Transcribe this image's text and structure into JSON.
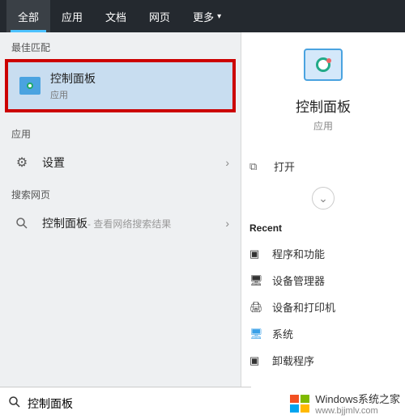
{
  "nav": {
    "all": "全部",
    "apps": "应用",
    "docs": "文档",
    "web": "网页",
    "more": "更多"
  },
  "sections": {
    "bestMatch": "最佳匹配",
    "apps": "应用",
    "searchWeb": "搜索网页"
  },
  "bestMatch": {
    "title": "控制面板",
    "sub": "应用"
  },
  "appResult": {
    "title": "设置"
  },
  "webResult": {
    "title": "控制面板",
    "hint": " - 查看网络搜索结果"
  },
  "preview": {
    "title": "控制面板",
    "sub": "应用",
    "open": "打开",
    "recent": "Recent",
    "recentItems": [
      "程序和功能",
      "设备管理器",
      "设备和打印机",
      "系统",
      "卸载程序"
    ]
  },
  "search": {
    "value": "控制面板",
    "placeholder": ""
  },
  "watermark": {
    "text": "Windows系统之家",
    "url": "www.bjjmlv.com"
  }
}
